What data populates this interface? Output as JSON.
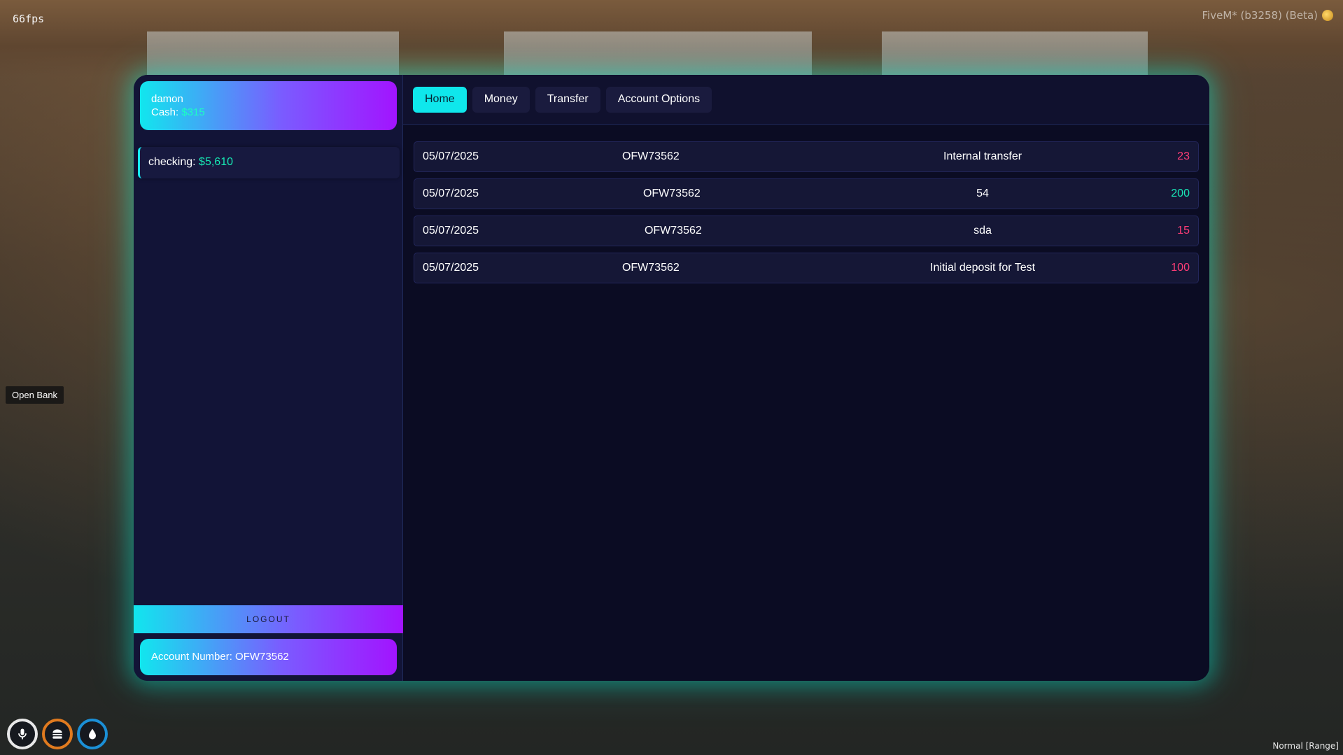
{
  "overlay": {
    "fps": "66fps",
    "client": "FiveM* (b3258) (Beta)",
    "open_bank_hint": "Open Bank",
    "voice_mode": "Normal [Range]"
  },
  "sidebar": {
    "user_name": "damon",
    "cash_label": "Cash:",
    "cash_value": "$315",
    "account": {
      "label": "checking:",
      "balance": "$5,610"
    },
    "logout_label": "LOGOUT",
    "account_number": "Account Number: OFW73562"
  },
  "tabs": [
    {
      "label": "Home",
      "active": true
    },
    {
      "label": "Money",
      "active": false
    },
    {
      "label": "Transfer",
      "active": false
    },
    {
      "label": "Account Options",
      "active": false
    }
  ],
  "transactions": [
    {
      "date": "05/07/2025",
      "account": "OFW73562",
      "description": "Internal transfer",
      "amount": "23",
      "type": "withdraw"
    },
    {
      "date": "05/07/2025",
      "account": "OFW73562",
      "description": "54",
      "amount": "200",
      "type": "deposit"
    },
    {
      "date": "05/07/2025",
      "account": "OFW73562",
      "description": "sda",
      "amount": "15",
      "type": "withdraw"
    },
    {
      "date": "05/07/2025",
      "account": "OFW73562",
      "description": "Initial deposit for Test",
      "amount": "100",
      "type": "withdraw"
    }
  ],
  "colors": {
    "accent": "#0fe7ec",
    "negative": "#ff3d77",
    "positive": "#19e6b6"
  },
  "hud": {
    "icons": [
      "microphone-icon",
      "burger-icon",
      "water-drop-icon"
    ]
  }
}
